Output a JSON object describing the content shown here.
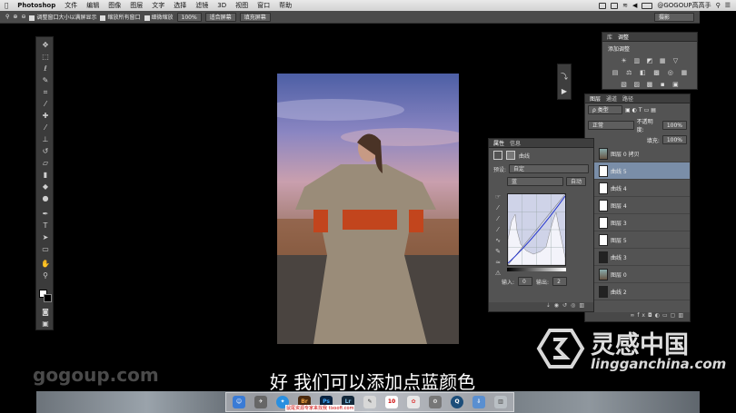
{
  "menubar": {
    "app": "Photoshop",
    "items": [
      "文件",
      "编辑",
      "图像",
      "图层",
      "文字",
      "选择",
      "滤镜",
      "3D",
      "视图",
      "窗口",
      "帮助"
    ],
    "user": "@GOGOUP高高手"
  },
  "options": {
    "resize_windows": "调整窗口大小以满屏显示",
    "zoom_all": "缩放所有窗口",
    "scrubby_zoom": "细微缩放",
    "zoom_pct": "100%",
    "fit_screen": "适合屏幕",
    "fill_screen": "填充屏幕",
    "workspace": "摄影"
  },
  "adjustments": {
    "tabs": [
      "库",
      "调整"
    ],
    "title": "添加调整",
    "icons_row1": [
      "☀",
      "▥",
      "◩",
      "▦",
      "▽"
    ],
    "icons_row2": [
      "▤",
      "⚖",
      "◧",
      "▩",
      "◎",
      "▦"
    ],
    "icons_row3": [
      "▧",
      "▨",
      "▩",
      "▪",
      "▣"
    ]
  },
  "layers": {
    "tabs": [
      "图层",
      "通道",
      "路径"
    ],
    "kind_label": "ρ 类型",
    "blend_mode": "正常",
    "opacity_label": "不透明度:",
    "opacity": "100%",
    "fill_label": "填充:",
    "fill": "100%",
    "items": [
      {
        "name": "图层 0 拷贝",
        "selected": false
      },
      {
        "name": "曲线 5",
        "selected": true
      },
      {
        "name": "曲线 4",
        "selected": false
      },
      {
        "name": "图层 4",
        "selected": false
      },
      {
        "name": "图层 3",
        "selected": false
      },
      {
        "name": "图层 5",
        "selected": false
      },
      {
        "name": "曲线 3",
        "selected": false
      },
      {
        "name": "图层 0",
        "selected": false
      },
      {
        "name": "曲线 2",
        "selected": false
      }
    ]
  },
  "curves": {
    "tabs": [
      "属性",
      "信息"
    ],
    "title": "曲线",
    "preset_label": "预设:",
    "preset_value": "自定",
    "channel": "蓝",
    "auto_label": "自动",
    "input_label": "输入:",
    "input_value": "0",
    "output_label": "输出:",
    "output_value": "2"
  },
  "watermark": "gogoup.com",
  "subtitle": "好 我们可以添加点蓝颜色",
  "brand": {
    "cn": "灵感中国",
    "url": "lingganchina.com"
  },
  "dock": {
    "apps": [
      "Br",
      "Ps",
      "Lr"
    ],
    "caption": "鼠尾资源专家来找我 tixsoft.com"
  }
}
